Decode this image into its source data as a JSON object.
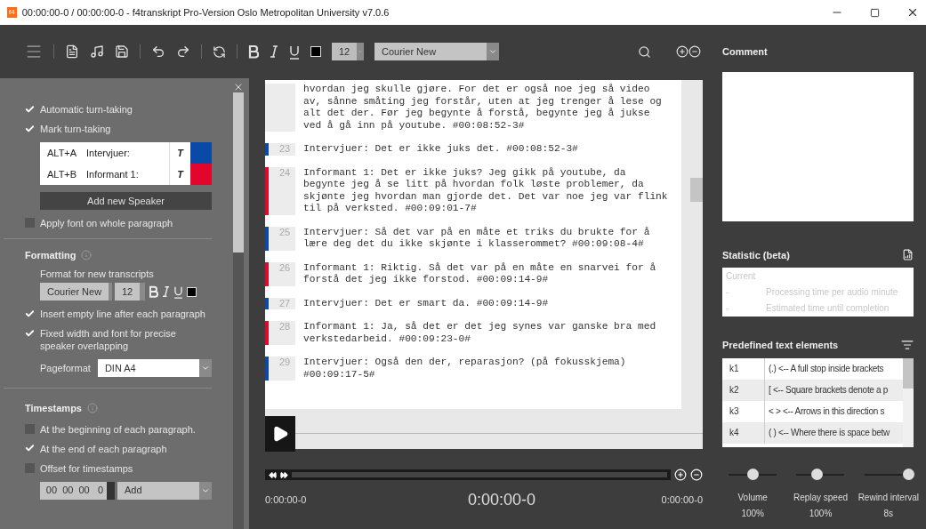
{
  "window": {
    "title": "00:00:00-0 / 00:00:00-0 -  f4transkript Pro-Version Oslo Metropolitan University v7.0.6",
    "app_badge": "f4"
  },
  "toolbar": {
    "font_size": "12",
    "font": "Courier New"
  },
  "settings": {
    "turn_taking": [
      {
        "label": "Automatic turn-taking",
        "checked": true
      },
      {
        "label": "Mark turn-taking",
        "checked": true
      }
    ],
    "speakers": [
      {
        "shortcut": "ALT+A",
        "name": "Intervjuer:",
        "style": "T",
        "color": "#0a4aa6"
      },
      {
        "shortcut": "ALT+B",
        "name": "Informant 1:",
        "style": "T",
        "color": "#e2062c"
      }
    ],
    "add_speaker": "Add new Speaker",
    "apply_font": {
      "label": "Apply font on whole paragraph",
      "checked": false
    },
    "formatting": {
      "title": "Formatting",
      "subtitle": "Format for new transcripts",
      "font": "Courier New",
      "size": "12",
      "options": [
        {
          "label": "Insert empty line after each paragraph",
          "checked": true
        },
        {
          "label": "Fixed width and font for precise speaker overlapping",
          "checked": true
        }
      ],
      "pageformat_label": "Pageformat",
      "pageformat": "DIN A4"
    },
    "timestamps": {
      "title": "Timestamps",
      "options": [
        {
          "label": "At the beginning of each paragraph.",
          "checked": false
        },
        {
          "label": "At the end of each paragraph",
          "checked": true
        },
        {
          "label": "Offset for timestamps",
          "checked": false
        }
      ],
      "offset": "00  00  00   0",
      "mode": "Add"
    }
  },
  "transcript": [
    {
      "text": "hvordan jeg skulle gjøre. For det er også noe jeg så video av, sånne småting jeg forstår, uten at jeg trenger å lese og alt det der. Før jeg begynte å forstå, begynte jeg å jukse ved å gå inn på youtube. #00:08:52-3#"
    },
    {
      "number": "23",
      "color": "#0a4aa6",
      "text": "Intervjuer: Det er ikke juks det. #00:08:52-3#"
    },
    {
      "number": "24",
      "color": "#e2062c",
      "text": "Informant 1: Det er ikke juks? Jeg gikk på youtube, da begynte jeg å se litt på hvordan folk løste problemer, da skjønte jeg hvordan man gjorde det. Det var noe jeg var flink til på verksted. #00:09:01-7#"
    },
    {
      "number": "25",
      "color": "#0a4aa6",
      "text": "Intervjuer: Så det var på en måte et triks du brukte for å lære deg det du ikke skjønte i klasserommet? #00:09:08-4#"
    },
    {
      "number": "26",
      "color": "#e2062c",
      "text": "Informant 1: Riktig. Så det var på en måte en snarvei for å forstå det jeg ikke forstod. #00:09:14-9#"
    },
    {
      "number": "27",
      "color": "#0a4aa6",
      "text": "Intervjuer: Det er smart da. #00:09:14-9#"
    },
    {
      "number": "28",
      "color": "#e2062c",
      "text": "Informant 1: Ja, så det er det jeg synes var ganske bra med verkstedarbeid. #00:09:23-0#"
    },
    {
      "number": "29",
      "color": "#0a4aa6",
      "text": "Intervjuer: Også den der, reparasjon? (på fokusskjema) #00:09:17-5#"
    }
  ],
  "player": {
    "start": "0:00:00-0",
    "current": "0:00:00-0",
    "end": "0:00:00-0"
  },
  "comment": {
    "title": "Comment"
  },
  "statistic": {
    "title": "Statistic (beta)",
    "current": "Current",
    "rows": [
      {
        "value": "-",
        "label": "Processing time per audio minute"
      },
      {
        "value": "-",
        "label": "Estimated time until completion"
      }
    ]
  },
  "predefined": {
    "title": "Predefined text elements",
    "rows": [
      {
        "key": "k1",
        "text": "(.) <-- A full stop inside brackets"
      },
      {
        "key": "k2",
        "text": "[ <-- Square brackets denote a p"
      },
      {
        "key": "k3",
        "text": "< > <-- Arrows in this direction s"
      },
      {
        "key": "k4",
        "text": "( ) <-- Where there is space betw"
      }
    ]
  },
  "sliders": [
    {
      "label": "Volume",
      "value": "100%",
      "level": 0.5
    },
    {
      "label": "Replay speed",
      "value": "100%",
      "level": 0.42
    },
    {
      "label": "Rewind interval",
      "value": "8s",
      "level": 0.92
    }
  ]
}
